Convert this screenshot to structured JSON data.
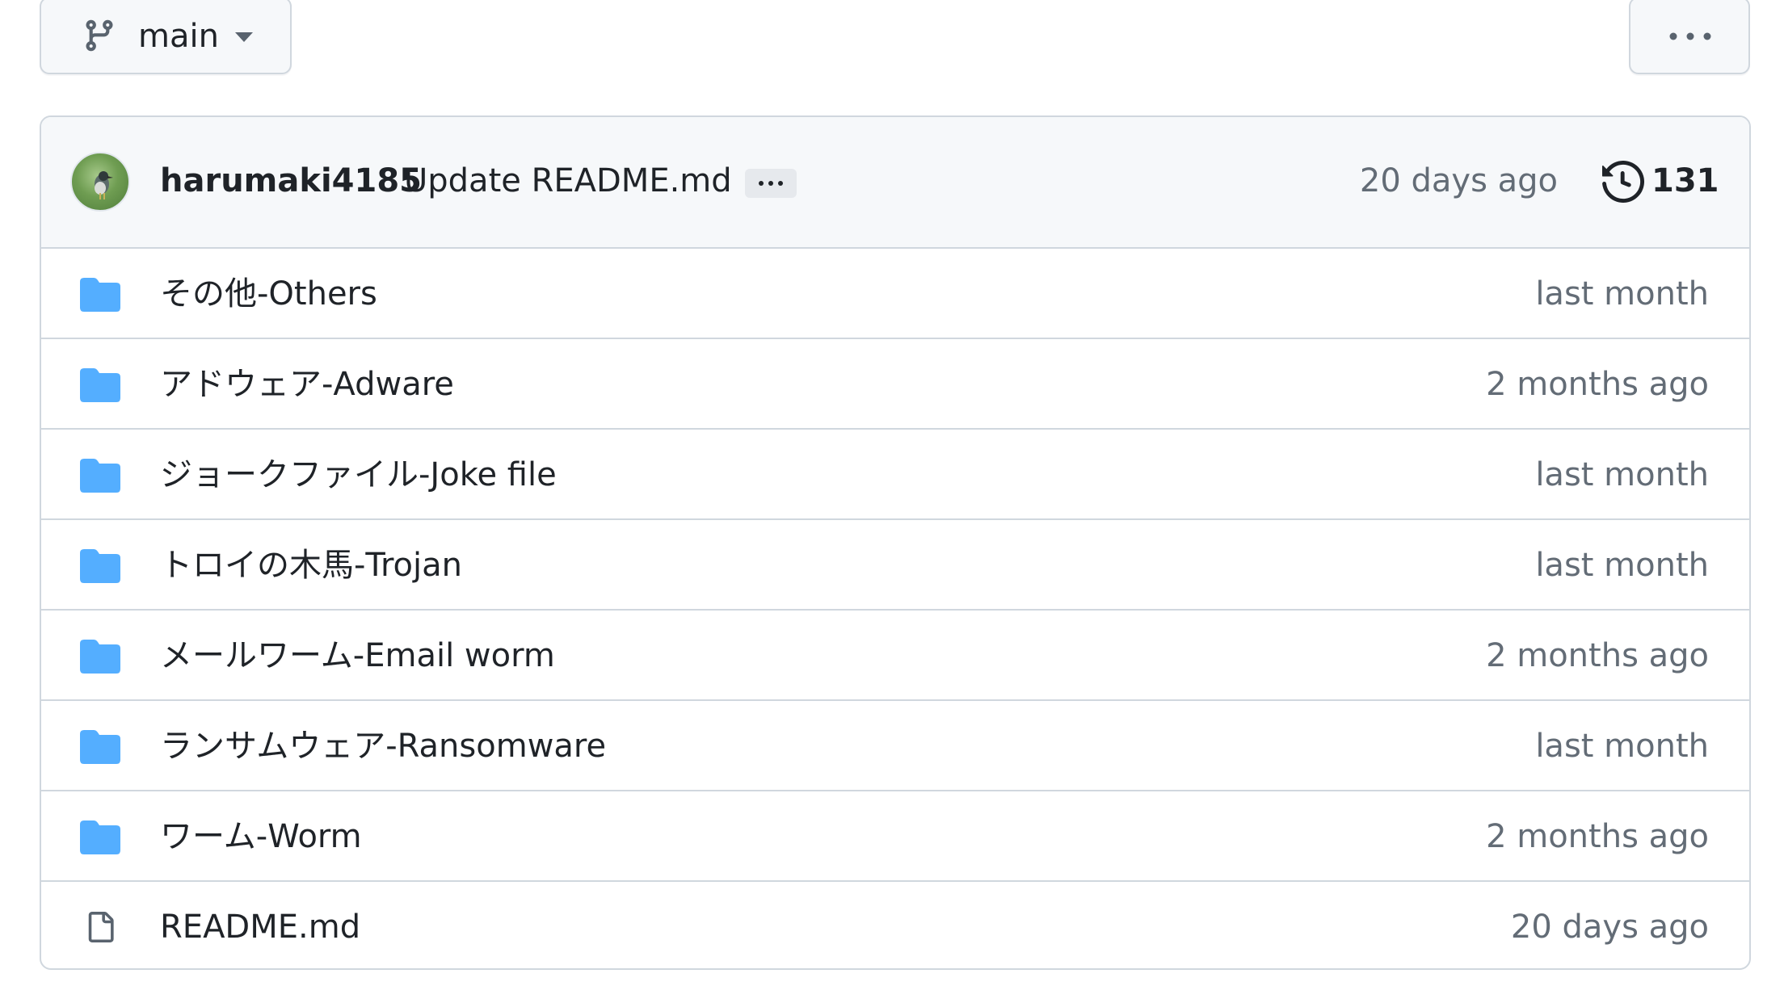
{
  "branch": {
    "name": "main",
    "icon": "git-branch-icon"
  },
  "more_actions": {
    "icon": "kebab-horizontal-icon"
  },
  "latest_commit": {
    "author": "harumaki4185",
    "message": "Update README.md",
    "time": "20 days ago",
    "history_count": "131"
  },
  "colors": {
    "folder": "#54aeff",
    "muted_text": "#636c76",
    "border": "#d0d7de",
    "header_bg": "#f6f8fa"
  },
  "files": [
    {
      "name": "その他-Others",
      "date": "last month",
      "type": "folder"
    },
    {
      "name": "アドウェア-Adware",
      "date": "2 months ago",
      "type": "folder"
    },
    {
      "name": "ジョークファイル-Joke file",
      "date": "last month",
      "type": "folder"
    },
    {
      "name": "トロイの木馬-Trojan",
      "date": "last month",
      "type": "folder"
    },
    {
      "name": "メールワーム-Email worm",
      "date": "2 months ago",
      "type": "folder"
    },
    {
      "name": "ランサムウェア-Ransomware",
      "date": "last month",
      "type": "folder"
    },
    {
      "name": "ワーム-Worm",
      "date": "2 months ago",
      "type": "folder"
    },
    {
      "name": "README.md",
      "date": "20 days ago",
      "type": "file"
    }
  ]
}
